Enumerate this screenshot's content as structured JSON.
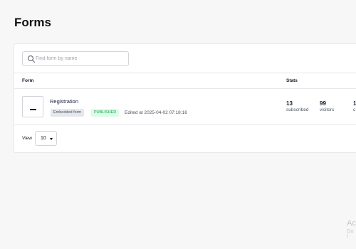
{
  "page": {
    "title": "Forms"
  },
  "search": {
    "placeholder": "Find form by name",
    "value": ""
  },
  "table": {
    "headers": {
      "form": "Form",
      "stats": "Stats"
    },
    "rows": [
      {
        "name": "Registration",
        "type_tag": "Embedded form",
        "status": "PUBLISHED",
        "edited": "Edited at 2025-04-02 07:18:16",
        "stats": [
          {
            "value": "13",
            "label": "subscribed"
          },
          {
            "value": "99",
            "label": "visitors"
          },
          {
            "value": "1",
            "label": "c"
          }
        ]
      }
    ]
  },
  "pagination": {
    "view_label": "View",
    "page_size": "10"
  },
  "watermark": {
    "line1": "Ac",
    "line2": "Go t"
  },
  "colors": {
    "published_text": "#16a34a",
    "published_bg": "#dcfce7",
    "background": "#f7f7f8"
  }
}
